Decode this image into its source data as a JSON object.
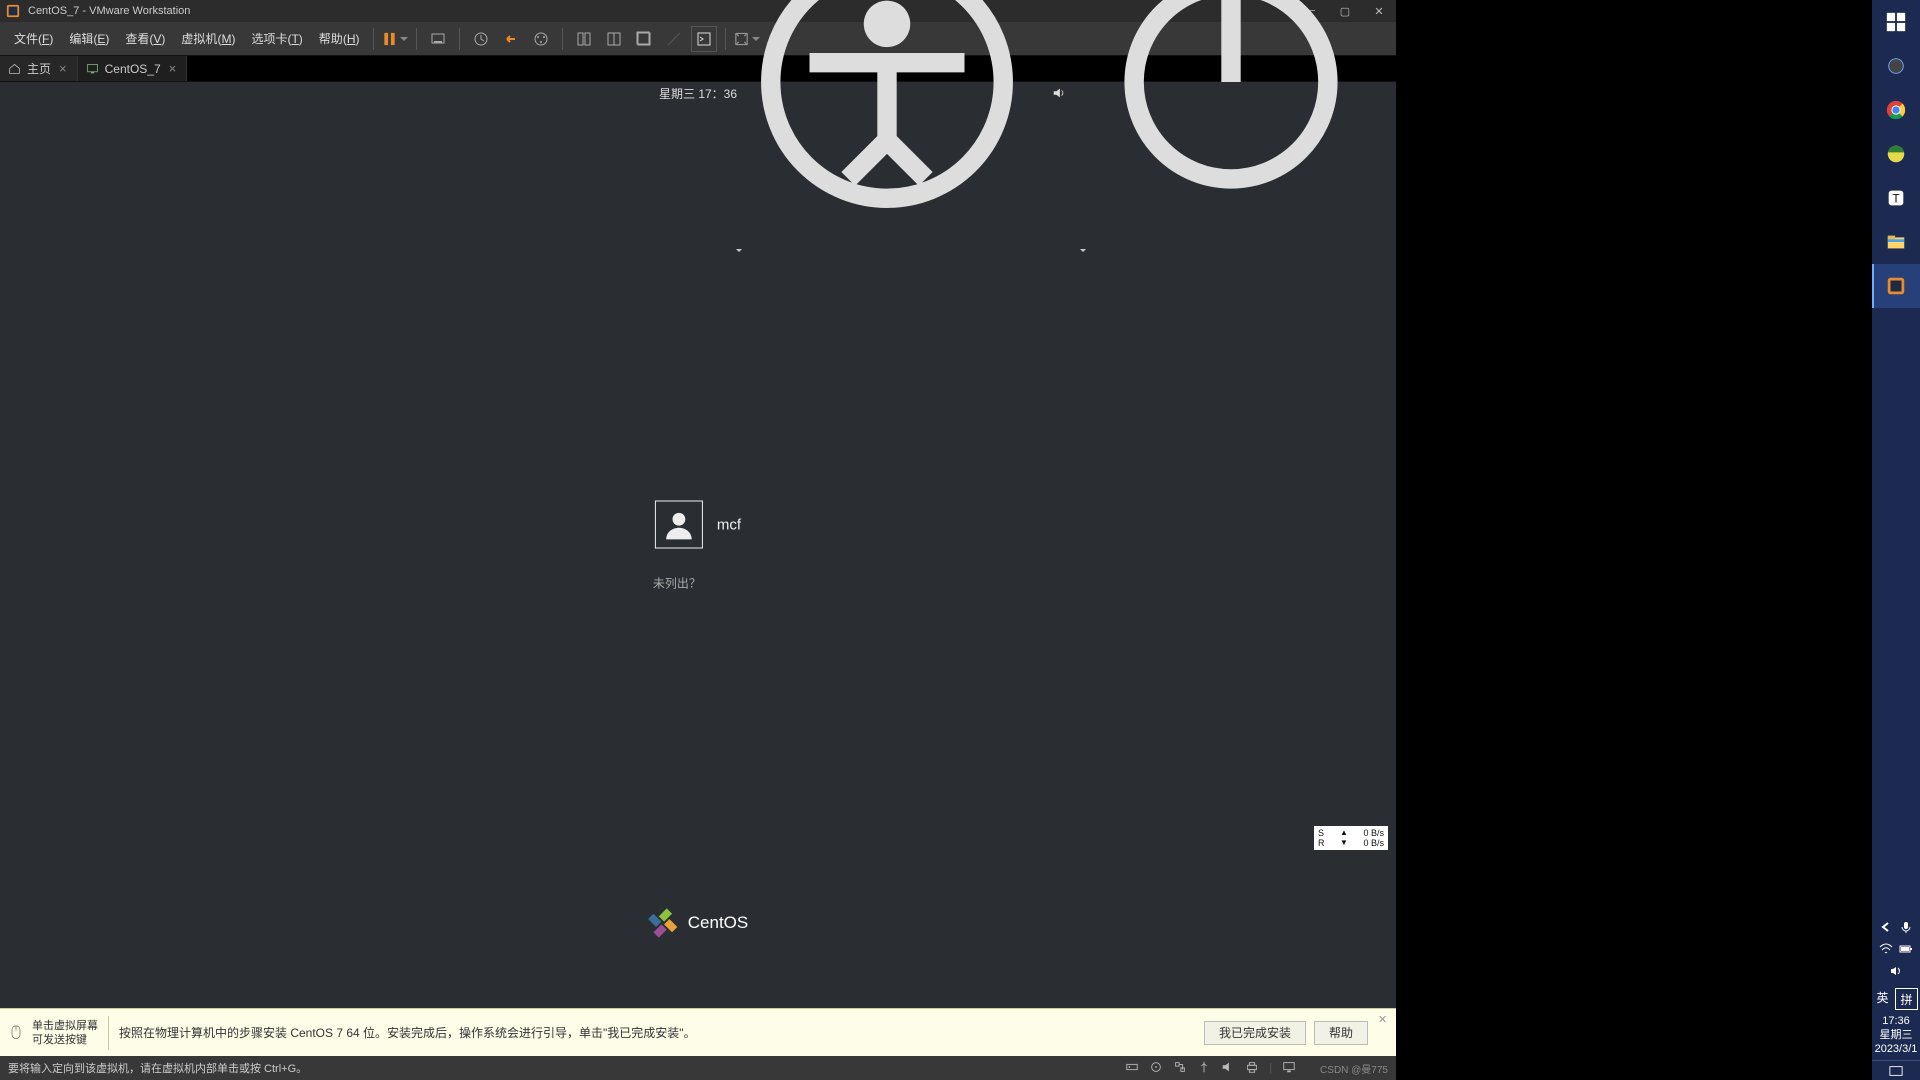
{
  "title": "CentOS_7 - VMware Workstation",
  "menus": {
    "file": {
      "label": "文件",
      "key": "F"
    },
    "edit": {
      "label": "编辑",
      "key": "E"
    },
    "view": {
      "label": "查看",
      "key": "V"
    },
    "vm": {
      "label": "虚拟机",
      "key": "M"
    },
    "tabs": {
      "label": "选项卡",
      "key": "T"
    },
    "help": {
      "label": "帮助",
      "key": "H"
    }
  },
  "tabs": {
    "home": {
      "label": "主页"
    },
    "vm": {
      "label": "CentOS_7"
    }
  },
  "gnome": {
    "clock": "星期三 17：36"
  },
  "login": {
    "username": "mcf",
    "notListed": "未列出？"
  },
  "centos": {
    "brand": "CentOS"
  },
  "netwidget": {
    "s_label": "S",
    "r_label": "R",
    "up": "0 B/s",
    "down": "0 B/s"
  },
  "yellowbar": {
    "hintLine1": "单击虚拟屏幕",
    "hintLine2": "可发送按键",
    "instruction": "按照在物理计算机中的步骤安装 CentOS 7 64 位。安装完成后，操作系统会进行引导，单击\"我已完成安装\"。",
    "doneBtn": "我已完成安装",
    "helpBtn": "帮助"
  },
  "statusbar": {
    "msg": "要将输入定向到该虚拟机，请在虚拟机内部单击或按 Ctrl+G。",
    "watermark": "CSDN @曼775"
  },
  "winTaskbar": {
    "ime1": "英",
    "ime2": "拼",
    "time": "17:36",
    "dow": "星期三",
    "date": "2023/3/1"
  }
}
